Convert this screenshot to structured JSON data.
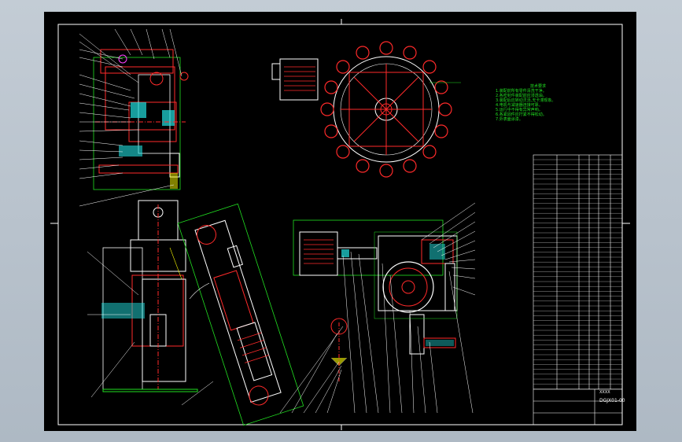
{
  "viewer": {
    "background_color": "#b9c3cd",
    "drawing_background": "#000000"
  },
  "drawing": {
    "code": "DGJX01-00",
    "tb_name": "XXXX",
    "notes_title": "技术要求",
    "notes": [
      "1.装配前所有零件清洗干净。",
      "2.各密封件装配前应浸透油。",
      "3.装配后应转动灵活,无卡滞现象。",
      "4.电机与减速器连接可靠。",
      "5.运行中不得有异常声响。",
      "6.各紧固件应拧紧不得松动。",
      "7.外表面涂漆。"
    ],
    "colors": {
      "line": "#ff2a2a",
      "green": "#21e021",
      "cyan": "#22e0e0",
      "white": "#ffffff",
      "yellow": "#ffff00",
      "magenta": "#ff40ff"
    }
  }
}
